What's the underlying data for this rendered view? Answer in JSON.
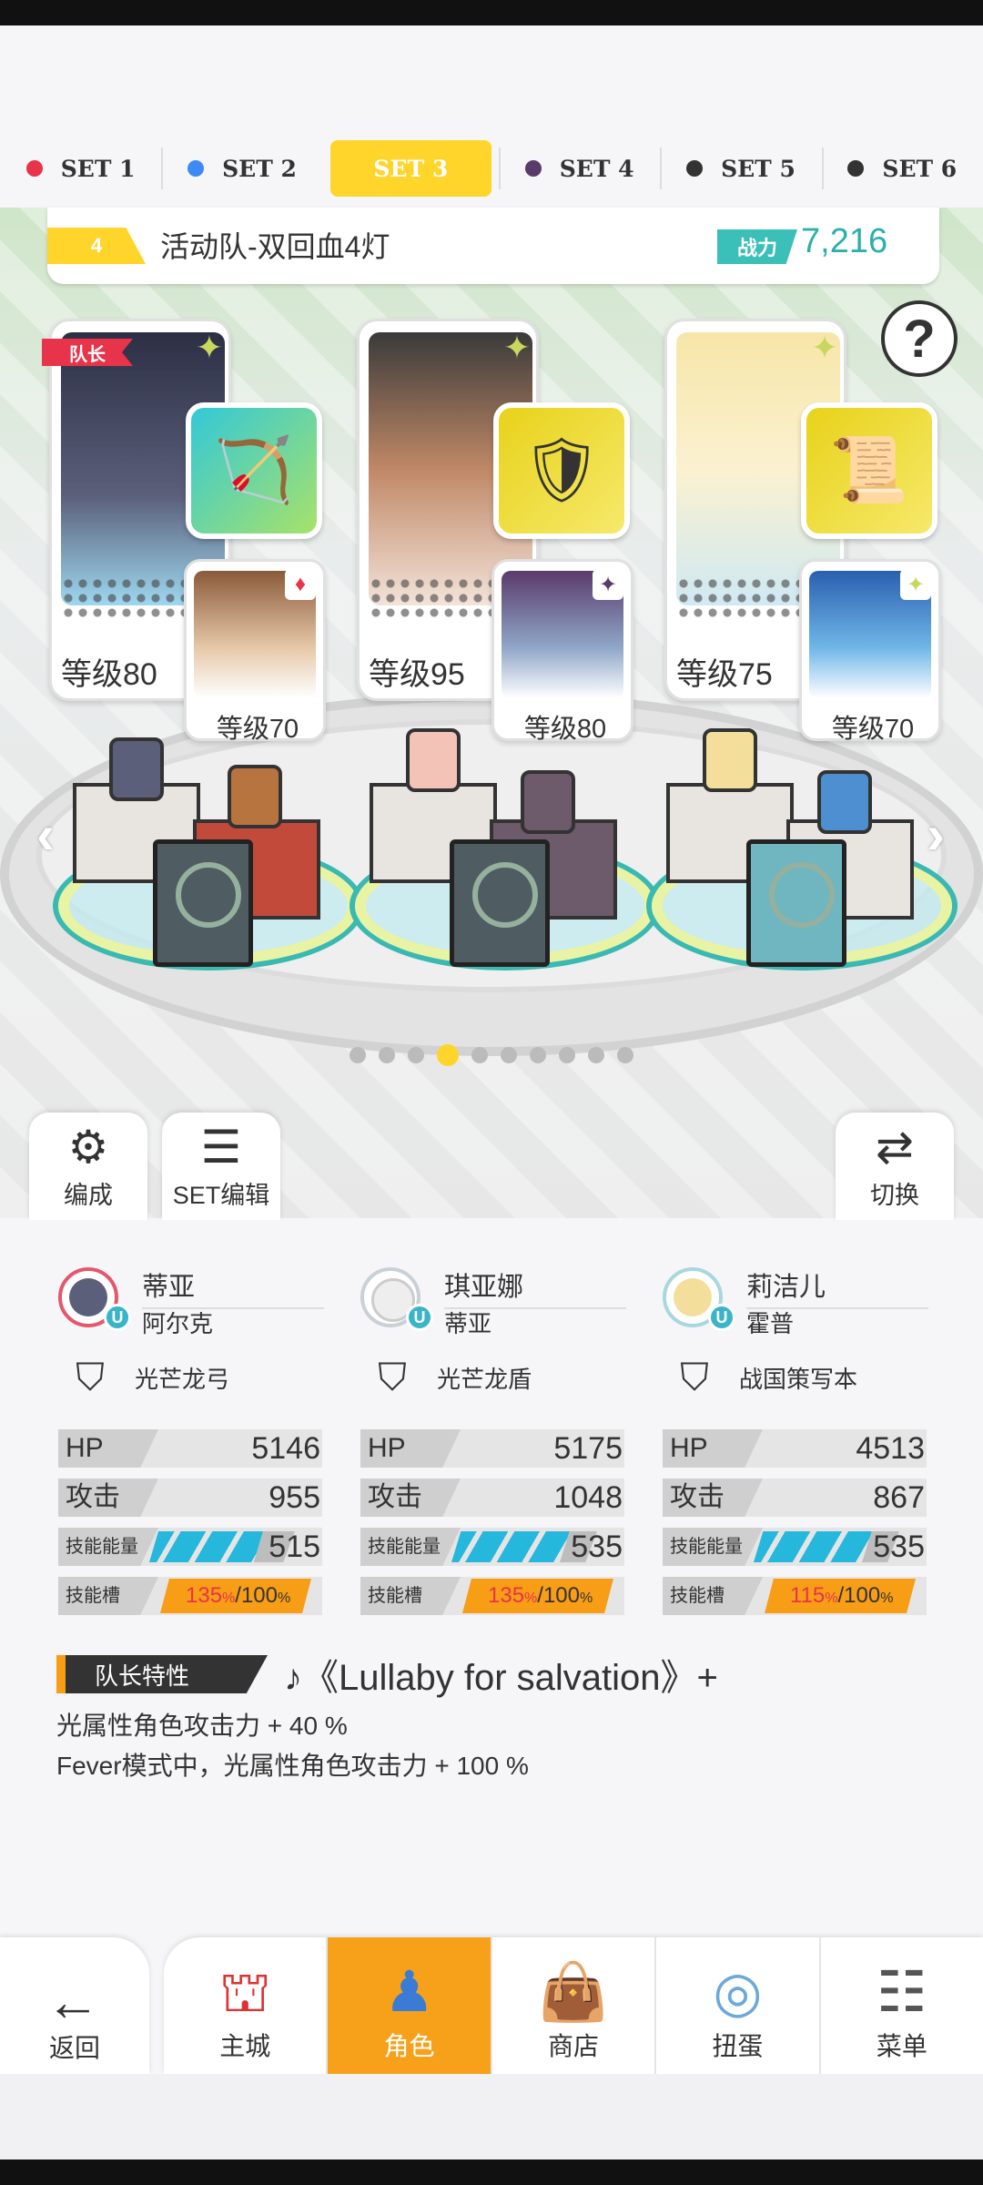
{
  "set_tabs": [
    {
      "label": "SET 1",
      "color": "#e8344a"
    },
    {
      "label": "SET 2",
      "color": "#3d8af7"
    },
    {
      "label": "SET 3",
      "color": "#ffd52b",
      "active": true
    },
    {
      "label": "SET 4",
      "color": "#5a3a6a"
    },
    {
      "label": "SET 5",
      "color": "#333333"
    },
    {
      "label": "SET 6",
      "color": "#333333"
    }
  ],
  "team": {
    "number": "4",
    "name": "活动队-双回血4灯",
    "power_label": "战力",
    "power_value": "7,216"
  },
  "help_icon": "question-icon",
  "characters": [
    {
      "leader_tag": "队长",
      "level": "等级80",
      "sub_level": "等级70",
      "name": "蒂亚",
      "sub_name": "阿尔克",
      "equip": "光芒龙弓",
      "hp_label": "HP",
      "hp": "5146",
      "atk_label": "攻击",
      "atk": "955",
      "energy_label": "技能能量",
      "energy": "515",
      "energy_fill": 0.78,
      "slot_label": "技能槽",
      "slot_cur": "135",
      "slot_total": "100",
      "slot_fill": 1.0
    },
    {
      "level": "等级95",
      "sub_level": "等级80",
      "name": "琪亚娜",
      "sub_name": "蒂亚",
      "equip": "光芒龙盾",
      "hp_label": "HP",
      "hp": "5175",
      "atk_label": "攻击",
      "atk": "1048",
      "energy_label": "技能能量",
      "energy": "535",
      "energy_fill": 0.81,
      "slot_label": "技能槽",
      "slot_cur": "135",
      "slot_total": "100",
      "slot_fill": 1.0
    },
    {
      "level": "等级75",
      "sub_level": "等级70",
      "name": "莉洁儿",
      "sub_name": "霍普",
      "equip": "战国策写本",
      "hp_label": "HP",
      "hp": "4513",
      "atk_label": "攻击",
      "atk": "867",
      "energy_label": "技能能量",
      "energy": "535",
      "energy_fill": 0.81,
      "slot_label": "技能槽",
      "slot_cur": "115",
      "slot_total": "100",
      "slot_fill": 1.0
    }
  ],
  "page_indicator": {
    "count": 10,
    "active": 3
  },
  "float_buttons": {
    "formation": "编成",
    "set_edit": "SET编辑",
    "switch": "切换"
  },
  "leader_skill": {
    "label": "队长特性",
    "song": "♪《Lullaby for salvation》+",
    "line1": "光属性角色攻击力 + 40 %",
    "line2": "Fever模式中，光属性角色攻击力 + 100 %"
  },
  "nav": {
    "back": "返回",
    "items": [
      {
        "label": "主城",
        "icon": "castle-icon"
      },
      {
        "label": "角色",
        "icon": "character-icon",
        "active": true
      },
      {
        "label": "商店",
        "icon": "shop-icon"
      },
      {
        "label": "扭蛋",
        "icon": "gacha-icon"
      },
      {
        "label": "菜单",
        "icon": "menu-icon"
      }
    ]
  },
  "percent_sign": "%"
}
